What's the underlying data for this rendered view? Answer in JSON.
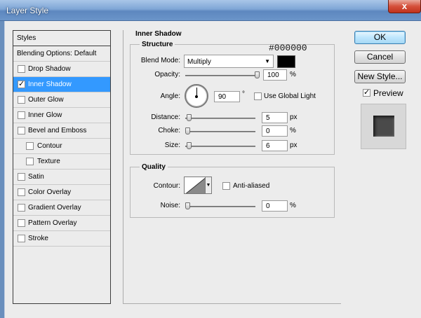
{
  "window": {
    "title": "Layer Style",
    "close_glyph": "x"
  },
  "sidebar": {
    "header": "Styles",
    "blending": "Blending Options: Default",
    "items": [
      {
        "label": "Drop Shadow",
        "checked": false
      },
      {
        "label": "Inner Shadow",
        "checked": true,
        "selected": true
      },
      {
        "label": "Outer Glow",
        "checked": false
      },
      {
        "label": "Inner Glow",
        "checked": false
      },
      {
        "label": "Bevel and Emboss",
        "checked": false
      },
      {
        "label": "Contour",
        "checked": false,
        "indent": true
      },
      {
        "label": "Texture",
        "checked": false,
        "indent": true
      },
      {
        "label": "Satin",
        "checked": false
      },
      {
        "label": "Color Overlay",
        "checked": false
      },
      {
        "label": "Gradient Overlay",
        "checked": false
      },
      {
        "label": "Pattern Overlay",
        "checked": false
      },
      {
        "label": "Stroke",
        "checked": false
      }
    ]
  },
  "panel": {
    "title": "Inner Shadow",
    "structure": {
      "title": "Structure",
      "blend_mode_label": "Blend Mode:",
      "blend_mode_value": "Multiply",
      "color_hex": "#000000",
      "opacity_label": "Opacity:",
      "opacity_value": "100",
      "opacity_unit": "%",
      "opacity_level": 1.0,
      "angle_label": "Angle:",
      "angle_value": "90",
      "angle_unit": "°",
      "use_global_light": "Use Global Light",
      "distance_label": "Distance:",
      "distance_value": "5",
      "distance_unit": "px",
      "distance_level": 0.02,
      "choke_label": "Choke:",
      "choke_value": "0",
      "choke_unit": "%",
      "choke_level": 0.0,
      "size_label": "Size:",
      "size_value": "6",
      "size_unit": "px",
      "size_level": 0.025
    },
    "quality": {
      "title": "Quality",
      "contour_label": "Contour:",
      "anti_aliased": "Anti-aliased",
      "noise_label": "Noise:",
      "noise_value": "0",
      "noise_unit": "%",
      "noise_level": 0.0
    }
  },
  "buttons": {
    "ok": "OK",
    "cancel": "Cancel",
    "new_style": "New Style...",
    "preview_label": "Preview",
    "preview_checked": true
  },
  "icons": {
    "close": "close-icon",
    "dropdown": "chevron-down-icon",
    "checkbox": "checkbox-icon"
  }
}
